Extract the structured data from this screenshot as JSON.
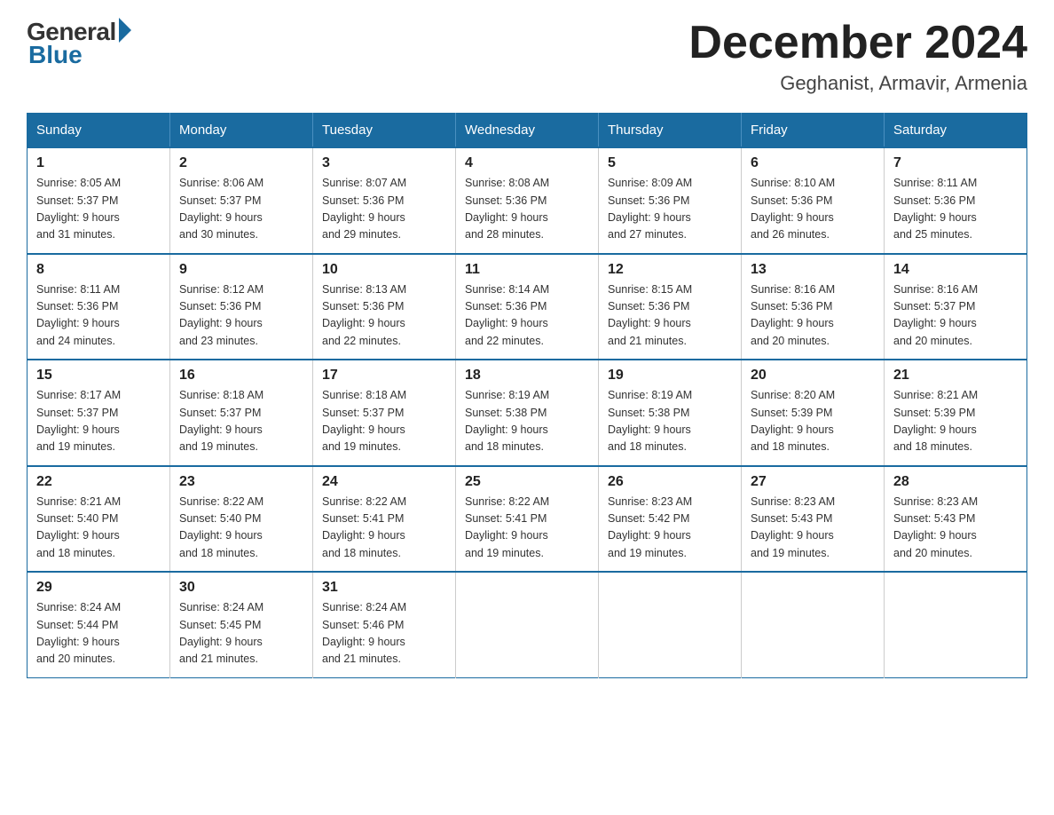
{
  "header": {
    "logo_general": "General",
    "logo_blue": "Blue",
    "month_title": "December 2024",
    "location": "Geghanist, Armavir, Armenia"
  },
  "days_of_week": [
    "Sunday",
    "Monday",
    "Tuesday",
    "Wednesday",
    "Thursday",
    "Friday",
    "Saturday"
  ],
  "weeks": [
    [
      {
        "day": "1",
        "sunrise": "8:05 AM",
        "sunset": "5:37 PM",
        "daylight": "9 hours and 31 minutes."
      },
      {
        "day": "2",
        "sunrise": "8:06 AM",
        "sunset": "5:37 PM",
        "daylight": "9 hours and 30 minutes."
      },
      {
        "day": "3",
        "sunrise": "8:07 AM",
        "sunset": "5:36 PM",
        "daylight": "9 hours and 29 minutes."
      },
      {
        "day": "4",
        "sunrise": "8:08 AM",
        "sunset": "5:36 PM",
        "daylight": "9 hours and 28 minutes."
      },
      {
        "day": "5",
        "sunrise": "8:09 AM",
        "sunset": "5:36 PM",
        "daylight": "9 hours and 27 minutes."
      },
      {
        "day": "6",
        "sunrise": "8:10 AM",
        "sunset": "5:36 PM",
        "daylight": "9 hours and 26 minutes."
      },
      {
        "day": "7",
        "sunrise": "8:11 AM",
        "sunset": "5:36 PM",
        "daylight": "9 hours and 25 minutes."
      }
    ],
    [
      {
        "day": "8",
        "sunrise": "8:11 AM",
        "sunset": "5:36 PM",
        "daylight": "9 hours and 24 minutes."
      },
      {
        "day": "9",
        "sunrise": "8:12 AM",
        "sunset": "5:36 PM",
        "daylight": "9 hours and 23 minutes."
      },
      {
        "day": "10",
        "sunrise": "8:13 AM",
        "sunset": "5:36 PM",
        "daylight": "9 hours and 22 minutes."
      },
      {
        "day": "11",
        "sunrise": "8:14 AM",
        "sunset": "5:36 PM",
        "daylight": "9 hours and 22 minutes."
      },
      {
        "day": "12",
        "sunrise": "8:15 AM",
        "sunset": "5:36 PM",
        "daylight": "9 hours and 21 minutes."
      },
      {
        "day": "13",
        "sunrise": "8:16 AM",
        "sunset": "5:36 PM",
        "daylight": "9 hours and 20 minutes."
      },
      {
        "day": "14",
        "sunrise": "8:16 AM",
        "sunset": "5:37 PM",
        "daylight": "9 hours and 20 minutes."
      }
    ],
    [
      {
        "day": "15",
        "sunrise": "8:17 AM",
        "sunset": "5:37 PM",
        "daylight": "9 hours and 19 minutes."
      },
      {
        "day": "16",
        "sunrise": "8:18 AM",
        "sunset": "5:37 PM",
        "daylight": "9 hours and 19 minutes."
      },
      {
        "day": "17",
        "sunrise": "8:18 AM",
        "sunset": "5:37 PM",
        "daylight": "9 hours and 19 minutes."
      },
      {
        "day": "18",
        "sunrise": "8:19 AM",
        "sunset": "5:38 PM",
        "daylight": "9 hours and 18 minutes."
      },
      {
        "day": "19",
        "sunrise": "8:19 AM",
        "sunset": "5:38 PM",
        "daylight": "9 hours and 18 minutes."
      },
      {
        "day": "20",
        "sunrise": "8:20 AM",
        "sunset": "5:39 PM",
        "daylight": "9 hours and 18 minutes."
      },
      {
        "day": "21",
        "sunrise": "8:21 AM",
        "sunset": "5:39 PM",
        "daylight": "9 hours and 18 minutes."
      }
    ],
    [
      {
        "day": "22",
        "sunrise": "8:21 AM",
        "sunset": "5:40 PM",
        "daylight": "9 hours and 18 minutes."
      },
      {
        "day": "23",
        "sunrise": "8:22 AM",
        "sunset": "5:40 PM",
        "daylight": "9 hours and 18 minutes."
      },
      {
        "day": "24",
        "sunrise": "8:22 AM",
        "sunset": "5:41 PM",
        "daylight": "9 hours and 18 minutes."
      },
      {
        "day": "25",
        "sunrise": "8:22 AM",
        "sunset": "5:41 PM",
        "daylight": "9 hours and 19 minutes."
      },
      {
        "day": "26",
        "sunrise": "8:23 AM",
        "sunset": "5:42 PM",
        "daylight": "9 hours and 19 minutes."
      },
      {
        "day": "27",
        "sunrise": "8:23 AM",
        "sunset": "5:43 PM",
        "daylight": "9 hours and 19 minutes."
      },
      {
        "day": "28",
        "sunrise": "8:23 AM",
        "sunset": "5:43 PM",
        "daylight": "9 hours and 20 minutes."
      }
    ],
    [
      {
        "day": "29",
        "sunrise": "8:24 AM",
        "sunset": "5:44 PM",
        "daylight": "9 hours and 20 minutes."
      },
      {
        "day": "30",
        "sunrise": "8:24 AM",
        "sunset": "5:45 PM",
        "daylight": "9 hours and 21 minutes."
      },
      {
        "day": "31",
        "sunrise": "8:24 AM",
        "sunset": "5:46 PM",
        "daylight": "9 hours and 21 minutes."
      },
      null,
      null,
      null,
      null
    ]
  ]
}
